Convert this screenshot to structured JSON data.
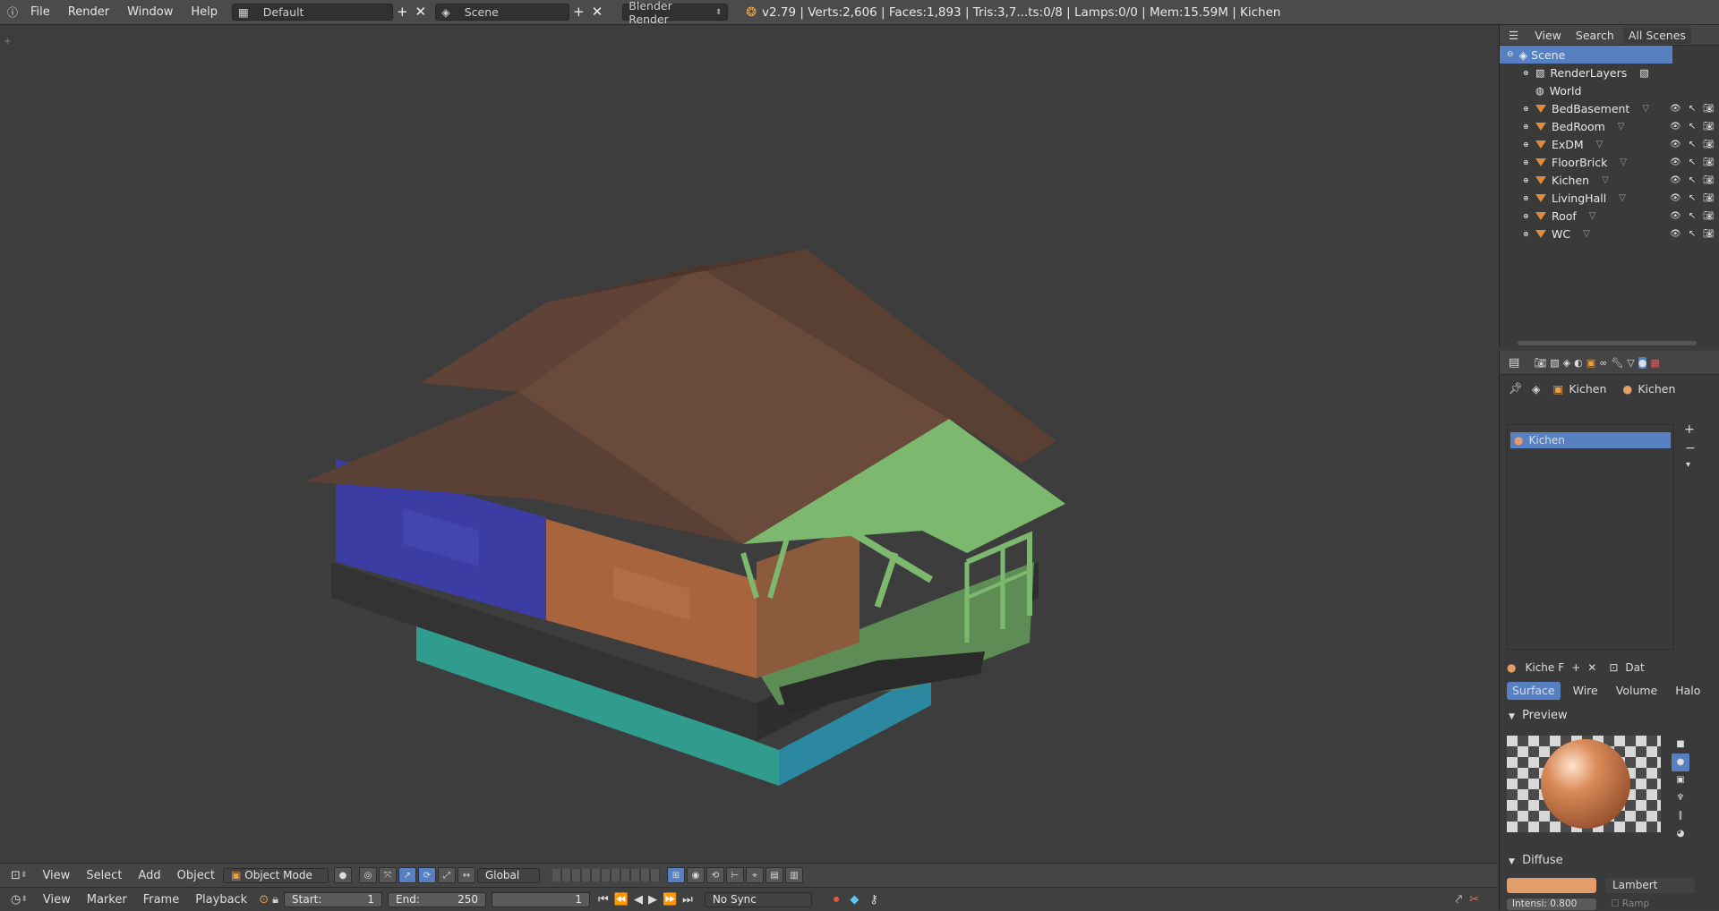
{
  "topbar": {
    "menus": [
      "File",
      "Render",
      "Window",
      "Help"
    ],
    "layout": "Default",
    "scene": "Scene",
    "engine": "Blender Render",
    "stats": "v2.79 | Verts:2,606 | Faces:1,893 | Tris:3,7...ts:0/8 | Lamps:0/0 | Mem:15.59M | Kichen"
  },
  "outliner": {
    "header": {
      "view": "View",
      "search": "Search",
      "scenes": "All Scenes"
    },
    "root": "Scene",
    "items": [
      {
        "label": "RenderLayers",
        "type": "renderlayers"
      },
      {
        "label": "World",
        "type": "world"
      },
      {
        "label": "BedBasement",
        "type": "mesh"
      },
      {
        "label": "BedRoom",
        "type": "mesh"
      },
      {
        "label": "ExDM",
        "type": "mesh"
      },
      {
        "label": "FloorBrick",
        "type": "mesh"
      },
      {
        "label": "Kichen",
        "type": "mesh"
      },
      {
        "label": "LivingHall",
        "type": "mesh"
      },
      {
        "label": "Roof",
        "type": "mesh"
      },
      {
        "label": "WC",
        "type": "mesh"
      }
    ]
  },
  "properties": {
    "breadcrumb_object": "Kichen",
    "breadcrumb_material": "Kichen",
    "slots": [
      "Kichen"
    ],
    "datablock": {
      "name": "Kiche",
      "fake": "F",
      "data": "Dat"
    },
    "tabs": [
      "Surface",
      "Wire",
      "Volume",
      "Halo"
    ],
    "active_tab": "Surface",
    "preview_label": "Preview",
    "diffuse_label": "Diffuse",
    "diffuse_shader": "Lambert",
    "diffuse_color": "#e49c6a",
    "intensity": "Intensi: 0.800",
    "ramp": "Ramp"
  },
  "viewport_header": {
    "menus": [
      "View",
      "Select",
      "Add",
      "Object"
    ],
    "mode": "Object Mode",
    "orientation": "Global"
  },
  "timeline": {
    "menus": [
      "View",
      "Marker",
      "Frame",
      "Playback"
    ],
    "start": "Start:",
    "start_value": "1",
    "end": "End:",
    "end_value": "250",
    "current": "1",
    "sync": "No Sync"
  },
  "colors": {
    "selection": "#5680c2",
    "roof": "#5b4035",
    "kitchen_green": "#7cb86e",
    "bedroom_blue": "#3b3da3",
    "living_orange": "#a8643c",
    "basement_teal": "#2f9c8e"
  }
}
